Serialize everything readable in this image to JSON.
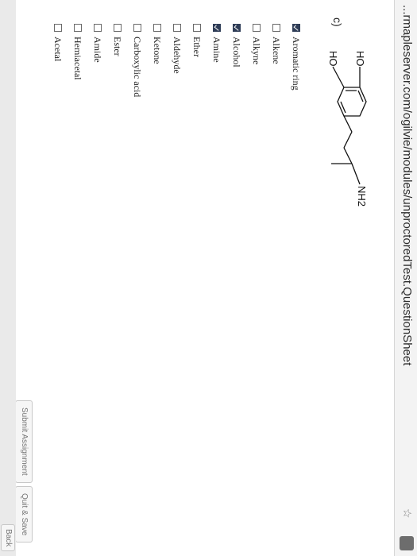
{
  "browser": {
    "url": "...rmapleserver.com/ogilvie/modules/unproctoredTest.QuestionSheet",
    "bookmark_icon": "star-icon"
  },
  "question": {
    "label": "c)",
    "molecule": {
      "ho_top": "HO",
      "ho_bottom": "HO",
      "nh2": "NH2"
    }
  },
  "options": [
    {
      "label": "Aromatic ring",
      "checked": true
    },
    {
      "label": "Alkene",
      "checked": false
    },
    {
      "label": "Alkyne",
      "checked": false
    },
    {
      "label": "Alcohol",
      "checked": true
    },
    {
      "label": "Amine",
      "checked": true
    },
    {
      "label": "Ether",
      "checked": false
    },
    {
      "label": "Aldehyde",
      "checked": false
    },
    {
      "label": "Ketone",
      "checked": false
    },
    {
      "label": "Carboxylic acid",
      "checked": false
    },
    {
      "label": "Ester",
      "checked": false
    },
    {
      "label": "Amide",
      "checked": false
    },
    {
      "label": "Hemiacetal",
      "checked": false
    },
    {
      "label": "Acetal",
      "checked": false
    }
  ],
  "buttons": {
    "submit": "Submit Assignment",
    "quit": "Quit & Save",
    "back": "Back"
  }
}
